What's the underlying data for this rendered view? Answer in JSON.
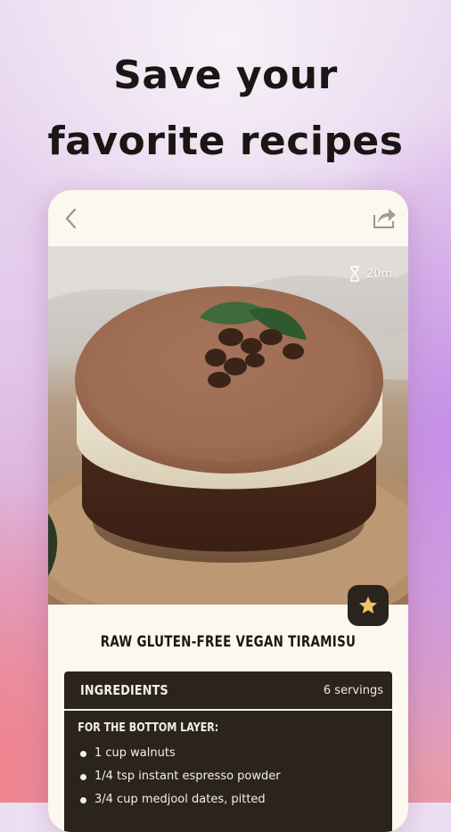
{
  "headline": {
    "line1": "Save your",
    "line2": "favorite recipes"
  },
  "topbar": {
    "back_icon": "chevron-left-icon",
    "share_icon": "share-icon"
  },
  "hero": {
    "time": "20m",
    "time_icon": "hourglass-icon"
  },
  "favorite": {
    "icon": "star-icon",
    "color": "#f2c36a"
  },
  "recipe": {
    "title": "RAW GLUTEN-FREE VEGAN TIRAMISU"
  },
  "ingredients": {
    "title": "INGREDIENTS",
    "servings": "6 servings",
    "section": "FOR THE BOTTOM LAYER:",
    "items": [
      "1 cup walnuts",
      "1/4 tsp instant espresso powder",
      "3/4 cup medjool dates, pitted"
    ]
  },
  "colors": {
    "panel": "#2b241c",
    "card": "#fbf8ef",
    "text": "#1d1812"
  }
}
